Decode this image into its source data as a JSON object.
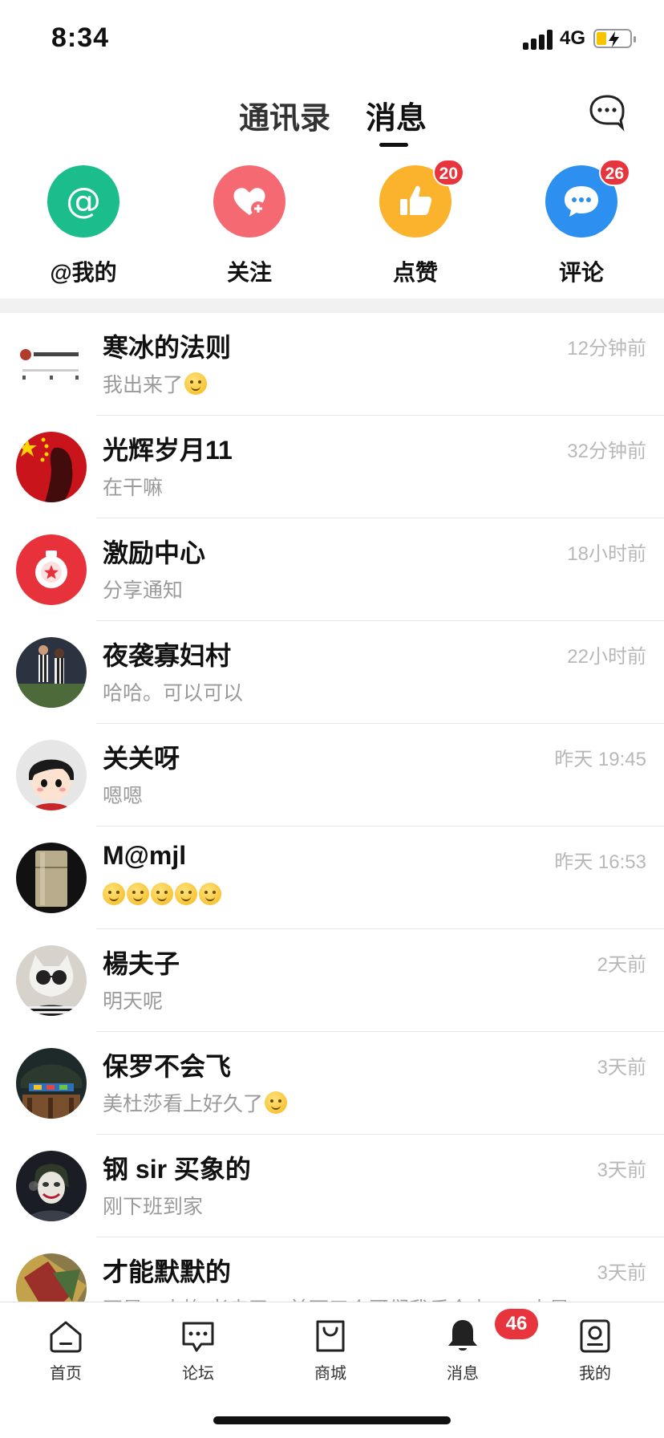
{
  "status": {
    "time": "8:34",
    "network": "4G"
  },
  "header": {
    "tabs": [
      {
        "label": "通讯录",
        "active": false
      },
      {
        "label": "消息",
        "active": true
      }
    ]
  },
  "quick": [
    {
      "label": "@我的",
      "icon": "at-icon",
      "color": "#1bbd8c",
      "badge": ""
    },
    {
      "label": "关注",
      "icon": "heart-plus-icon",
      "color": "#f56a72",
      "badge": ""
    },
    {
      "label": "点赞",
      "icon": "thumbs-up-icon",
      "color": "#fbb22d",
      "badge": "20"
    },
    {
      "label": "评论",
      "icon": "chat-bubble-icon",
      "color": "#2d8ff0",
      "badge": "26"
    }
  ],
  "messages": [
    {
      "name": "寒冰的法则",
      "preview": "我出来了",
      "emoji": 1,
      "time": "12分钟前"
    },
    {
      "name": "光辉岁月11",
      "preview": "在干嘛",
      "emoji": 0,
      "time": "32分钟前"
    },
    {
      "name": "激励中心",
      "preview": "分享通知",
      "emoji": 0,
      "time": "18小时前"
    },
    {
      "name": "夜袭寡妇村",
      "preview": "哈哈。可以可以",
      "emoji": 0,
      "time": "22小时前"
    },
    {
      "name": "关关呀",
      "preview": "嗯嗯",
      "emoji": 0,
      "time": "昨天 19:45"
    },
    {
      "name": "M@mjl",
      "preview": "",
      "emoji": 5,
      "time": "昨天 16:53"
    },
    {
      "name": "楊夫子",
      "preview": "明天呢",
      "emoji": 0,
      "time": "2天前"
    },
    {
      "name": "保罗不会飞",
      "preview": "美杜莎看上好久了",
      "emoji": 1,
      "time": "3天前"
    },
    {
      "name": "钢 sir 买象的",
      "preview": "刚下班到家",
      "emoji": 0,
      "time": "3天前"
    },
    {
      "name": "才能默默的",
      "preview": "不是，水均 者走了，前面三个哥们我乐会去……水是",
      "emoji": 0,
      "time": "3天前"
    }
  ],
  "nav": [
    {
      "label": "首页",
      "icon": "home-icon"
    },
    {
      "label": "论坛",
      "icon": "forum-icon"
    },
    {
      "label": "商城",
      "icon": "shopping-bag-icon"
    },
    {
      "label": "消息",
      "icon": "bell-icon",
      "badge": "46"
    },
    {
      "label": "我的",
      "icon": "profile-icon"
    }
  ]
}
